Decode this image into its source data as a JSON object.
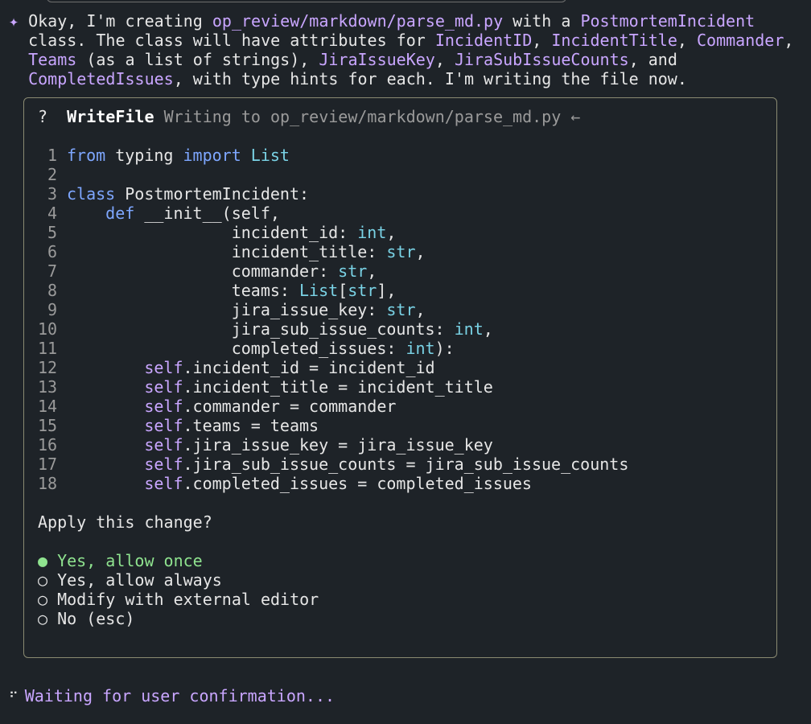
{
  "message": {
    "line1": [
      {
        "t": "Okay, I'm creating ",
        "c": "tx"
      },
      {
        "t": "op_review/markdown/parse_md.py",
        "c": "hl"
      },
      {
        "t": " with a ",
        "c": "tx"
      },
      {
        "t": "PostmortemIncident",
        "c": "hl"
      }
    ],
    "line2": [
      {
        "t": "class. The class will have attributes for ",
        "c": "tx"
      },
      {
        "t": "IncidentID",
        "c": "hl"
      },
      {
        "t": ", ",
        "c": "tx"
      },
      {
        "t": "IncidentTitle",
        "c": "hl"
      },
      {
        "t": ", ",
        "c": "tx"
      },
      {
        "t": "Commander",
        "c": "hl"
      },
      {
        "t": ",",
        "c": "tx"
      }
    ],
    "line3": [
      {
        "t": "Teams",
        "c": "hl"
      },
      {
        "t": " (as a list of strings), ",
        "c": "tx"
      },
      {
        "t": "JiraIssueKey",
        "c": "hl"
      },
      {
        "t": ", ",
        "c": "tx"
      },
      {
        "t": "JiraSubIssueCounts",
        "c": "hl"
      },
      {
        "t": ", and",
        "c": "tx"
      }
    ],
    "line4": [
      {
        "t": "CompletedIssues",
        "c": "hl"
      },
      {
        "t": ", with type hints for each. I'm writing the file now.",
        "c": "tx"
      }
    ]
  },
  "tool": {
    "status_icon": "?",
    "name": "WriteFile",
    "description": "Writing to op_review/markdown/parse_md.py",
    "arrow": "←"
  },
  "code": [
    {
      "n": "1",
      "parts": [
        {
          "t": "from",
          "c": "kw"
        },
        {
          "t": " typing ",
          "c": "tx"
        },
        {
          "t": "import",
          "c": "kw"
        },
        {
          "t": " ",
          "c": "tx"
        },
        {
          "t": "List",
          "c": "ty"
        }
      ]
    },
    {
      "n": "2",
      "parts": []
    },
    {
      "n": "3",
      "parts": [
        {
          "t": "class",
          "c": "kw"
        },
        {
          "t": " PostmortemIncident:",
          "c": "tx"
        }
      ]
    },
    {
      "n": "4",
      "parts": [
        {
          "t": "    ",
          "c": "tx"
        },
        {
          "t": "def",
          "c": "kw"
        },
        {
          "t": " __init__(self,",
          "c": "tx"
        }
      ]
    },
    {
      "n": "5",
      "parts": [
        {
          "t": "                 incident_id: ",
          "c": "tx"
        },
        {
          "t": "int",
          "c": "ty"
        },
        {
          "t": ",",
          "c": "tx"
        }
      ]
    },
    {
      "n": "6",
      "parts": [
        {
          "t": "                 incident_title: ",
          "c": "tx"
        },
        {
          "t": "str",
          "c": "ty"
        },
        {
          "t": ",",
          "c": "tx"
        }
      ]
    },
    {
      "n": "7",
      "parts": [
        {
          "t": "                 commander: ",
          "c": "tx"
        },
        {
          "t": "str",
          "c": "ty"
        },
        {
          "t": ",",
          "c": "tx"
        }
      ]
    },
    {
      "n": "8",
      "parts": [
        {
          "t": "                 teams: ",
          "c": "tx"
        },
        {
          "t": "List",
          "c": "ty"
        },
        {
          "t": "[",
          "c": "tx"
        },
        {
          "t": "str",
          "c": "ty"
        },
        {
          "t": "],",
          "c": "tx"
        }
      ]
    },
    {
      "n": "9",
      "parts": [
        {
          "t": "                 jira_issue_key: ",
          "c": "tx"
        },
        {
          "t": "str",
          "c": "ty"
        },
        {
          "t": ",",
          "c": "tx"
        }
      ]
    },
    {
      "n": "10",
      "parts": [
        {
          "t": "                 jira_sub_issue_counts: ",
          "c": "tx"
        },
        {
          "t": "int",
          "c": "ty"
        },
        {
          "t": ",",
          "c": "tx"
        }
      ]
    },
    {
      "n": "11",
      "parts": [
        {
          "t": "                 completed_issues: ",
          "c": "tx"
        },
        {
          "t": "int",
          "c": "ty"
        },
        {
          "t": "):",
          "c": "tx"
        }
      ]
    },
    {
      "n": "12",
      "parts": [
        {
          "t": "        ",
          "c": "tx"
        },
        {
          "t": "self",
          "c": "sf"
        },
        {
          "t": ".incident_id = incident_id",
          "c": "tx"
        }
      ]
    },
    {
      "n": "13",
      "parts": [
        {
          "t": "        ",
          "c": "tx"
        },
        {
          "t": "self",
          "c": "sf"
        },
        {
          "t": ".incident_title = incident_title",
          "c": "tx"
        }
      ]
    },
    {
      "n": "14",
      "parts": [
        {
          "t": "        ",
          "c": "tx"
        },
        {
          "t": "self",
          "c": "sf"
        },
        {
          "t": ".commander = commander",
          "c": "tx"
        }
      ]
    },
    {
      "n": "15",
      "parts": [
        {
          "t": "        ",
          "c": "tx"
        },
        {
          "t": "self",
          "c": "sf"
        },
        {
          "t": ".teams = teams",
          "c": "tx"
        }
      ]
    },
    {
      "n": "16",
      "parts": [
        {
          "t": "        ",
          "c": "tx"
        },
        {
          "t": "self",
          "c": "sf"
        },
        {
          "t": ".jira_issue_key = jira_issue_key",
          "c": "tx"
        }
      ]
    },
    {
      "n": "17",
      "parts": [
        {
          "t": "        ",
          "c": "tx"
        },
        {
          "t": "self",
          "c": "sf"
        },
        {
          "t": ".jira_sub_issue_counts = jira_sub_issue_counts",
          "c": "tx"
        }
      ]
    },
    {
      "n": "18",
      "parts": [
        {
          "t": "        ",
          "c": "tx"
        },
        {
          "t": "self",
          "c": "sf"
        },
        {
          "t": ".completed_issues = completed_issues",
          "c": "tx"
        }
      ]
    }
  ],
  "prompt": "Apply this change?",
  "options": [
    {
      "bullet": "●",
      "label": "Yes, allow once",
      "selected": true
    },
    {
      "bullet": "○",
      "label": "Yes, allow always",
      "selected": false
    },
    {
      "bullet": "○",
      "label": "Modify with external editor",
      "selected": false
    },
    {
      "bullet": "○",
      "label": "No (esc)",
      "selected": false
    }
  ],
  "status": {
    "spinner": "⠋",
    "text": "Waiting for user confirmation..."
  },
  "colors": {
    "background": "#1e2328",
    "accent": "#c9a6ff",
    "keyword": "#7ea7ff",
    "type": "#7ad3e6",
    "selected": "#8fe38f"
  }
}
